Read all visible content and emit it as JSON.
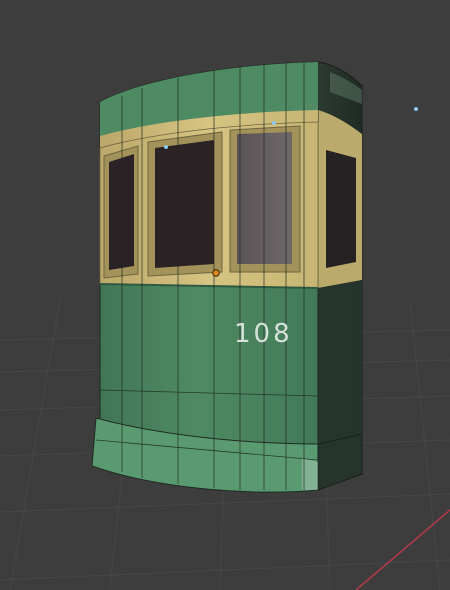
{
  "viewport": {
    "background": "#3d3d3d",
    "grid_color": "#484848",
    "x_axis_color": "#b5384a"
  },
  "model": {
    "number_text": "108",
    "body_color": "#4f8a62",
    "body_dark": "#2f5a41",
    "trim_color": "#cdbb78",
    "window_color": "#2a2224",
    "wire_color": "#1e2a22"
  },
  "gizmos": {
    "origin_color": "#e08a1c",
    "light_color": "#8ec8ef"
  }
}
